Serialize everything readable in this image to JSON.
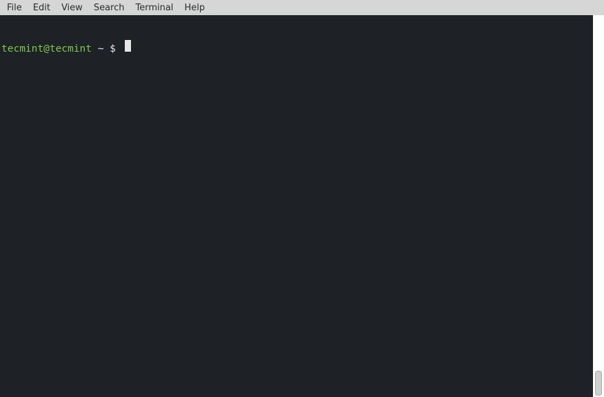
{
  "menubar": {
    "items": [
      {
        "label": "File"
      },
      {
        "label": "Edit"
      },
      {
        "label": "View"
      },
      {
        "label": "Search"
      },
      {
        "label": "Terminal"
      },
      {
        "label": "Help"
      }
    ]
  },
  "terminal": {
    "prompt": {
      "user_host": "tecmint@tecmint",
      "separator": " ",
      "path": "~",
      "dollar": " $ "
    },
    "colors": {
      "background": "#1e2227",
      "prompt_user": "#7ec84a",
      "text": "#e6e6e6"
    }
  }
}
